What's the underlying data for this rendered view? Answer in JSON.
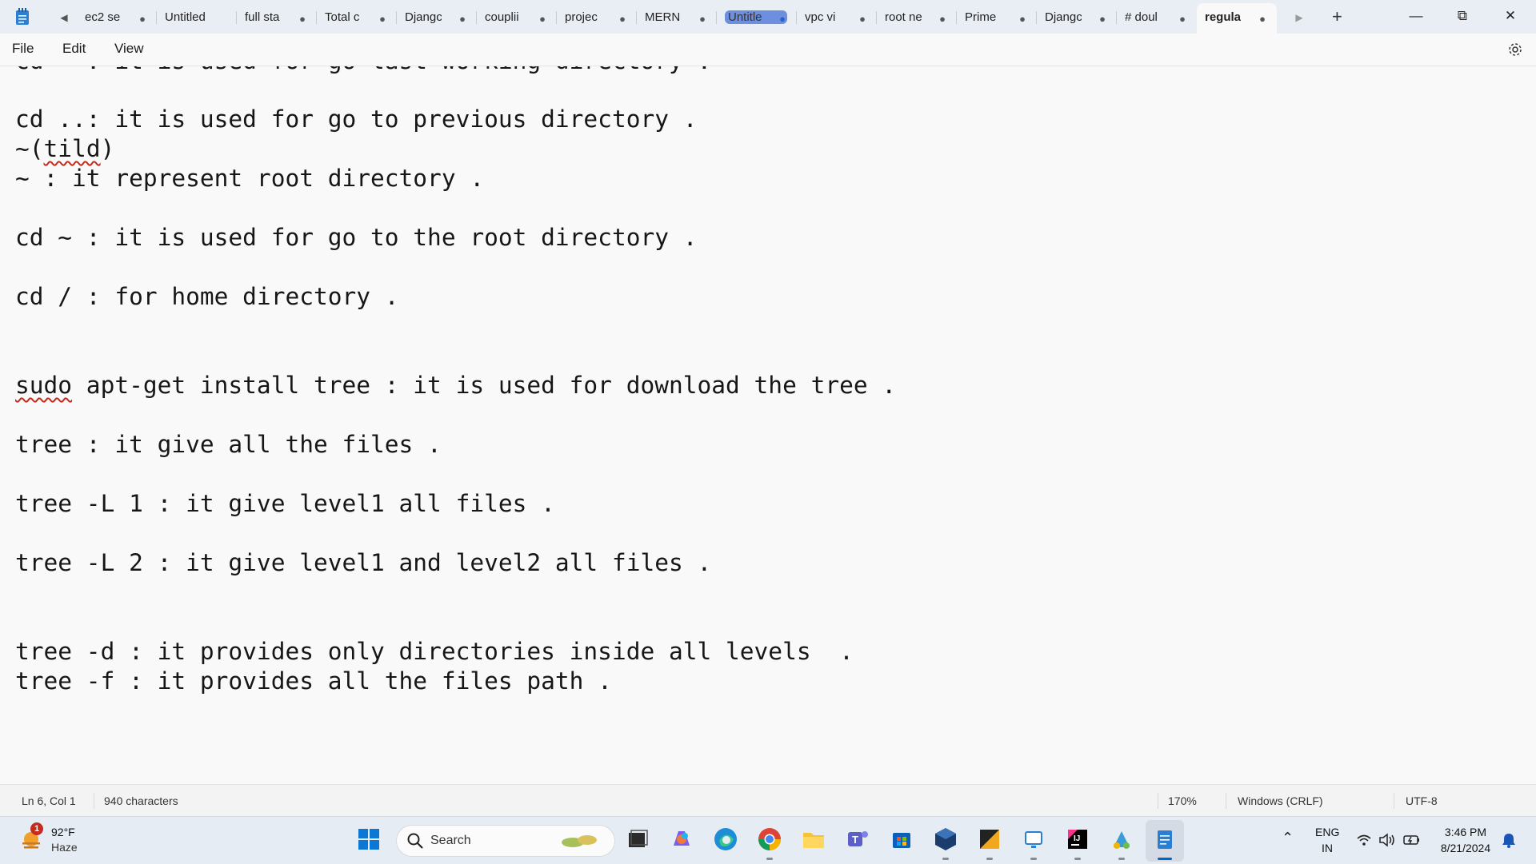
{
  "tabs": [
    {
      "label": "ec2  se",
      "dot": "●"
    },
    {
      "label": "Untitled",
      "dot": ""
    },
    {
      "label": "full sta",
      "dot": "●"
    },
    {
      "label": "Total c",
      "dot": "●"
    },
    {
      "label": "Djangc",
      "dot": "●"
    },
    {
      "label": "couplii",
      "dot": "●"
    },
    {
      "label": "projec",
      "dot": "●"
    },
    {
      "label": "MERN",
      "dot": "●"
    },
    {
      "label": "Untitle",
      "dot": "●"
    },
    {
      "label": "vpc  vi",
      "dot": "●"
    },
    {
      "label": "root nе",
      "dot": "●"
    },
    {
      "label": "Prime",
      "dot": "●"
    },
    {
      "label": "Djangc",
      "dot": "●"
    },
    {
      "label": "# doul",
      "dot": "●"
    },
    {
      "label": "regula",
      "dot": "●"
    }
  ],
  "menu": {
    "file": "File",
    "edit": "Edit",
    "view": "View"
  },
  "editor": {
    "lines": [
      "cd - : it is used for go last working directory .",
      "",
      "cd ..: it is used for go to previous directory .",
      "~(tild)",
      "~ : it represent root directory .",
      "",
      "cd ~ : it is used for go to the root directory .",
      "",
      "cd / : for home directory .",
      "",
      "",
      "sudo apt-get install tree : it is used for download the tree .",
      "",
      "tree : it give all the files .",
      "",
      "tree -L 1 : it give level1 all files .",
      "",
      "tree -L 2 : it give level1 and level2 all files .",
      "",
      "",
      "tree -d : it provides only directories inside all levels  .",
      "tree -f : it provides all the files path ."
    ],
    "line3_pre": "~(",
    "line3_word": "tild",
    "line3_post": ")",
    "line11_word": "sudo",
    "line11_post": " apt-get install tree : it is used for download the tree ."
  },
  "status": {
    "position": "Ln 6, Col 1",
    "chars": "940 characters",
    "zoom": "170%",
    "eol": "Windows (CRLF)",
    "encoding": "UTF-8"
  },
  "taskbar": {
    "weather_badge": "1",
    "temperature": "92°F",
    "condition": "Haze",
    "search_placeholder": "Search",
    "lang_top": "ENG",
    "lang_bottom": "IN",
    "time": "3:46 PM",
    "date": "8/21/2024"
  },
  "colors": {
    "accent": "#0067c0",
    "tab_highlight": "#6d8fe0"
  }
}
